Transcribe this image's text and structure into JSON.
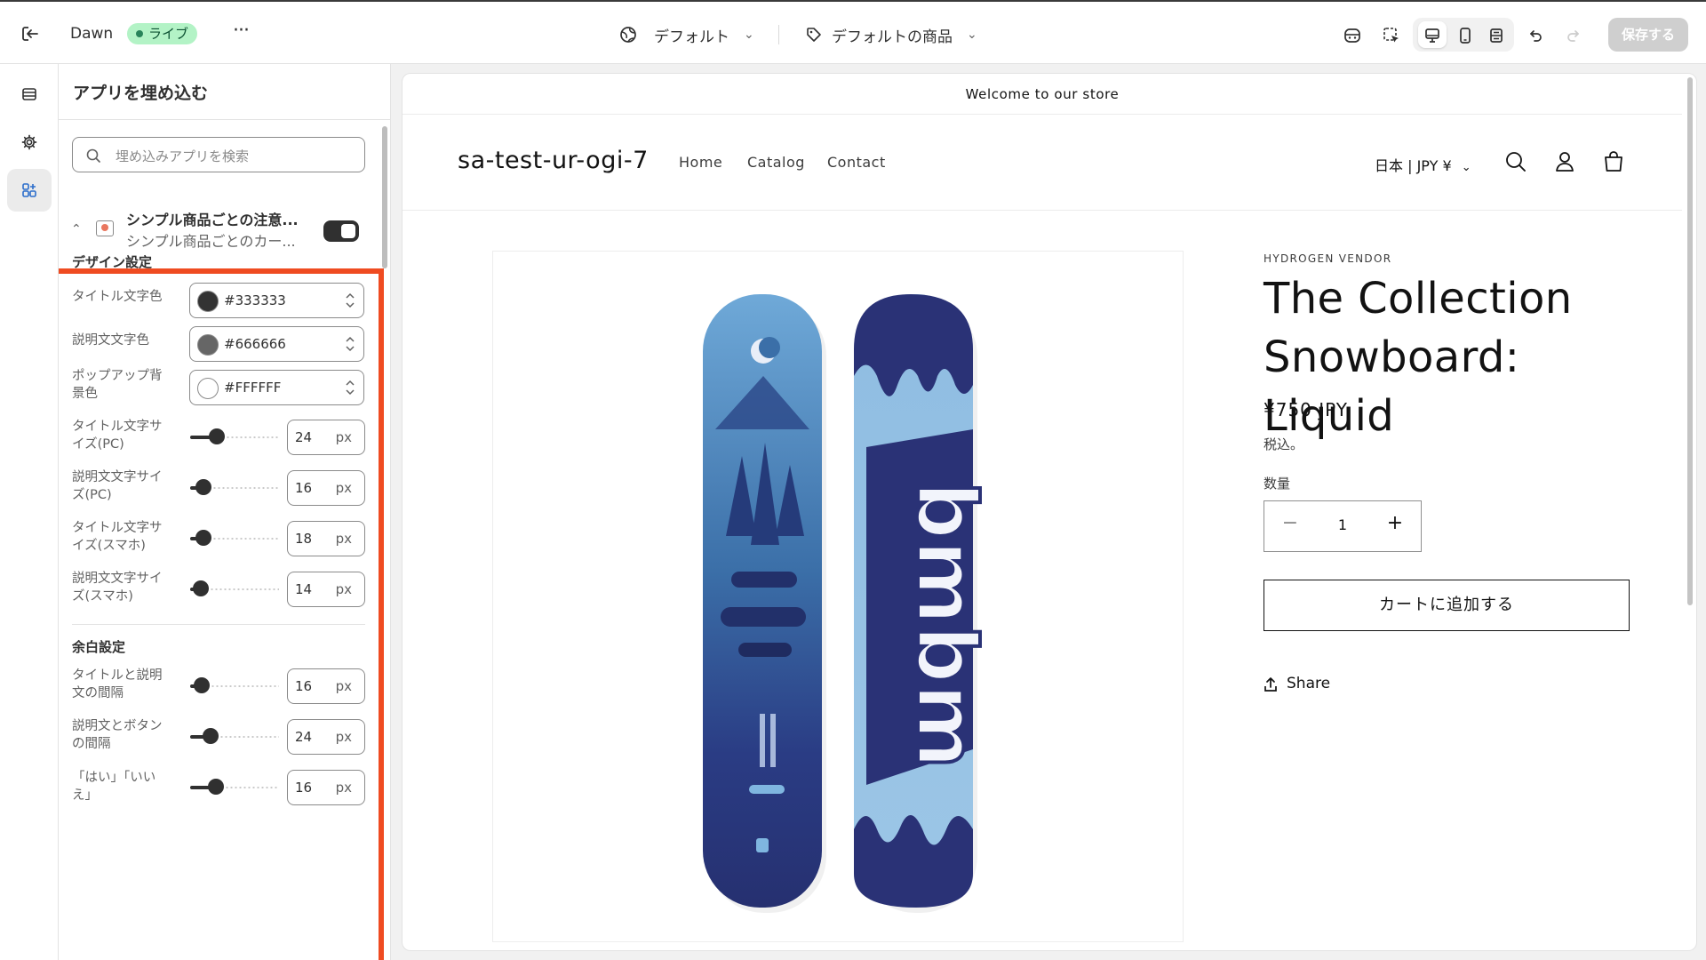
{
  "topbar": {
    "theme_name": "Dawn",
    "status_badge": "ライブ",
    "more": "···",
    "template_selector": "デフォルト",
    "product_selector": "デフォルトの商品",
    "save_label": "保存する"
  },
  "panel": {
    "title": "アプリを埋め込む",
    "search_placeholder": "埋め込みアプリを検索",
    "app_block": {
      "title": "シンプル商品ごとの注意...",
      "subtitle": "シンプル商品ごとのカー...",
      "enabled": true
    },
    "design_section": {
      "title": "デザイン設定",
      "colors": [
        {
          "label": "タイトル文字色",
          "value": "#333333",
          "swatch": "#333333"
        },
        {
          "label": "説明文文字色",
          "value": "#666666",
          "swatch": "#666666"
        },
        {
          "label": "ポップアップ背景色",
          "value": "#FFFFFF",
          "swatch": "#FFFFFF"
        }
      ],
      "sliders": [
        {
          "label": "タイトル文字サイズ(PC)",
          "value": "24",
          "unit": "px",
          "level": 0.3
        },
        {
          "label": "説明文文字サイズ(PC)",
          "value": "16",
          "unit": "px",
          "level": 0.15
        },
        {
          "label": "タイトル文字サイズ(スマホ)",
          "value": "18",
          "unit": "px",
          "level": 0.15
        },
        {
          "label": "説明文文字サイズ(スマホ)",
          "value": "14",
          "unit": "px",
          "level": 0.12
        }
      ]
    },
    "spacing_section": {
      "title": "余白設定",
      "sliders": [
        {
          "label": "タイトルと説明文の間隔",
          "value": "16",
          "unit": "px",
          "level": 0.13
        },
        {
          "label": "説明文とボタンの間隔",
          "value": "24",
          "unit": "px",
          "level": 0.23
        },
        {
          "label": "「はい」「いいえ」",
          "value": "16",
          "unit": "px",
          "level": 0.29
        }
      ]
    }
  },
  "preview": {
    "announcement": "Welcome to our store",
    "store_name": "sa-test-ur-ogi-7",
    "nav": [
      "Home",
      "Catalog",
      "Contact"
    ],
    "locale": "日本 | JPY ¥",
    "product": {
      "vendor": "HYDROGEN VENDOR",
      "title": "The Collection Snowboard: Liquid",
      "price": "¥750 JPY",
      "tax_note": "税込。",
      "quantity_label": "数量",
      "quantity": "1",
      "add_to_cart": "カートに追加する",
      "share": "Share"
    }
  },
  "colors": {
    "highlight": "#ef4b21",
    "live_badge_bg": "#b3f3c6",
    "live_badge_text": "#0c5132"
  }
}
